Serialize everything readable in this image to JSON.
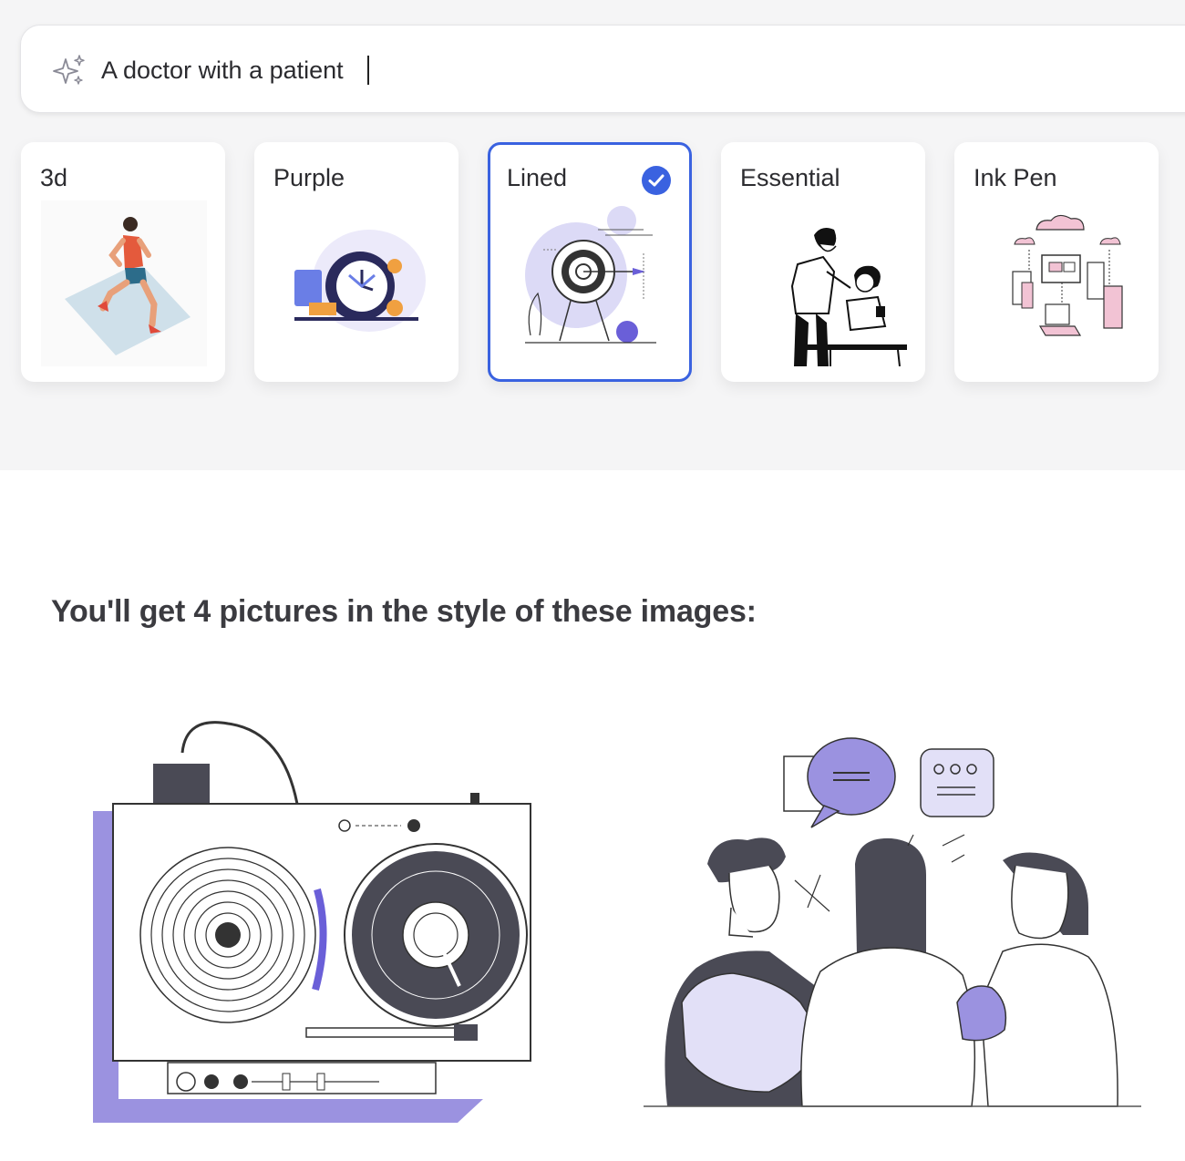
{
  "prompt": {
    "value": "A doctor with a patient",
    "icon": "sparkle-icon"
  },
  "styles": [
    {
      "label": "3d",
      "selected": false
    },
    {
      "label": "Purple",
      "selected": false
    },
    {
      "label": "Lined",
      "selected": true
    },
    {
      "label": "Essential",
      "selected": false
    },
    {
      "label": "Ink Pen",
      "selected": false
    }
  ],
  "preview": {
    "heading": "You'll get 4 pictures in the style of these images:"
  },
  "colors": {
    "accent": "#3a62e0",
    "illustration_purple": "#9b92e0",
    "illustration_dark": "#4a4a55",
    "illustration_light": "#e2e0f7"
  }
}
